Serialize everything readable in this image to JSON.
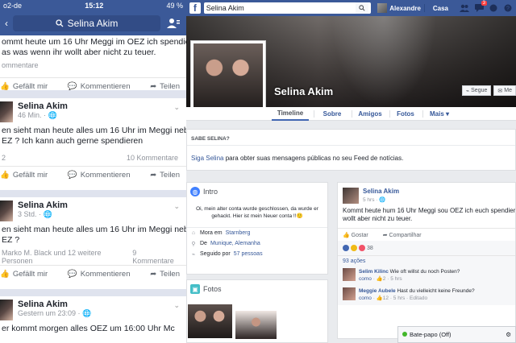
{
  "mobile": {
    "status": {
      "carrier": "o2-de",
      "time": "15:12",
      "battery": "49 %"
    },
    "search_title": "Selina Akim",
    "post1": {
      "text_line1": "ommt heute um 16 Uhr Meggi im OEZ ich spendiere",
      "text_line2": "as was wenn ihr wollt aber nicht zu teuer.",
      "comments": "ommentare",
      "like": "Gefällt mir",
      "comment": "Kommentieren",
      "share": "Teilen"
    },
    "post2": {
      "name": "Selina Akim",
      "time": "46 Min.",
      "text_line1": "en sieht man heute alles um 16 Uhr im Meggi neben",
      "text_line2": "EZ ? Ich kann auch gerne spendieren",
      "likes": "2",
      "comments": "10 Kommentare",
      "like": "Gefällt mir",
      "comment": "Kommentieren",
      "share": "Teilen"
    },
    "post3": {
      "name": "Selina Akim",
      "time": "3 Std.",
      "text_line1": "en sieht man heute alles um 16 Uhr im Meggi neben",
      "text_line2": "EZ ?",
      "likes": "Marko M. Black und 12 weitere Personen",
      "comments": "9 Kommentare",
      "like": "Gefällt mir",
      "comment": "Kommentieren",
      "share": "Teilen"
    },
    "post4": {
      "name": "Selina Akim",
      "time": "Gestern um 23:09",
      "text_line1": "er kommt morgen alles OEZ um 16:00 Uhr Mc"
    }
  },
  "desktop": {
    "search_value": "Selina Akim",
    "user_name": "Alexandre",
    "home": "Casa",
    "notif_badge": "3",
    "profile_name": "Selina Akim",
    "follow_button": "Segue",
    "more_button": "Me",
    "tabs": [
      "Timeline",
      "Sobre",
      "Amigos",
      "Fotos",
      "Mais ▾"
    ],
    "sabe": {
      "header": "SABE SELINA?",
      "link": "Siga Selina",
      "text": " para obter suas mensagens públicas no seu Feed de notícias."
    },
    "intro": {
      "title": "Intro",
      "bio": "Oi, mein alter conta wurde geschlossen, da wurde er gehackt. Hier ist mein Neuer conta !!🙂",
      "lives_prefix": "Mora em ",
      "lives_link": "Starnberg",
      "from_prefix": "De ",
      "from_link": "Munique, Alemanha",
      "followed_prefix": "Seguido por ",
      "followed_link": "57 pessoas"
    },
    "fotos": {
      "title": "Fotos"
    },
    "post": {
      "name": "Selina Akim",
      "time": "5 hrs",
      "text_line1": "Kommt heute hum 16 Uhr Meggi sou OEZ ich euch spendiere",
      "text_line2": "wollt aber nicht zu teuer.",
      "like": "Gostar",
      "share": "Compartilhar",
      "reactions_count": "38",
      "shares": "93 ações",
      "comments": [
        {
          "name": "Selim Kilinc",
          "text": " Wie oft willst du noch Posten?",
          "meta": "como",
          "likes": "2",
          "time": "5 hrs"
        },
        {
          "name": "Meggie Aubele",
          "text": " Hast du vielleicht keine Freunde?",
          "meta": "como",
          "likes": "12",
          "time": "5 hrs · Editado"
        }
      ]
    },
    "chat": {
      "label": "Bate-papo (Off)"
    }
  }
}
